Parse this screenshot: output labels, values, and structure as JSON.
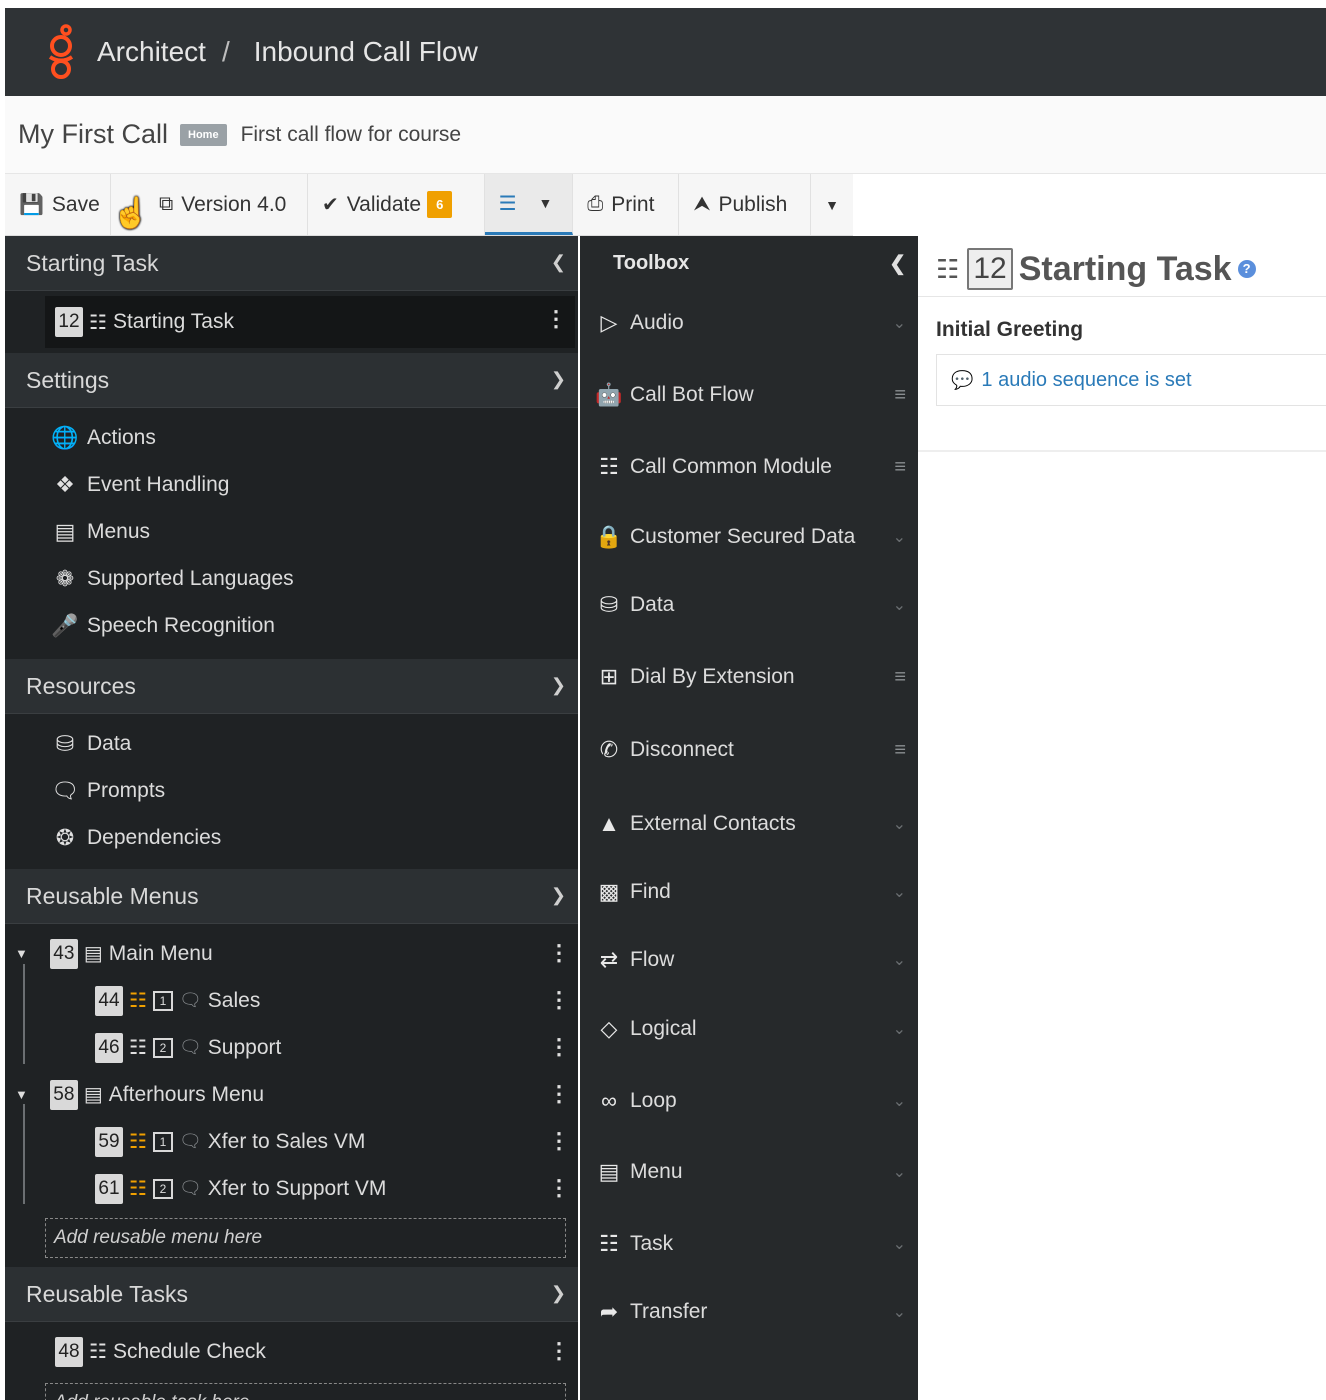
{
  "topbar": {
    "app": "Architect",
    "separator": "/",
    "flow_type": "Inbound Call Flow"
  },
  "flow": {
    "name": "My First Call",
    "badge": "Home",
    "description": "First call flow for course"
  },
  "toolbar": {
    "save": "Save",
    "version": "Version 4.0",
    "validate": "Validate",
    "validate_count": "6",
    "print": "Print",
    "publish": "Publish"
  },
  "starting_task_section": {
    "title": "Starting Task",
    "item": {
      "number": "12",
      "label": "Starting Task"
    }
  },
  "settings": {
    "title": "Settings",
    "items": [
      {
        "label": "Actions",
        "icon": "globe-icon"
      },
      {
        "label": "Event Handling",
        "icon": "event-handling-icon"
      },
      {
        "label": "Menus",
        "icon": "menu-list-icon"
      },
      {
        "label": "Supported Languages",
        "icon": "language-icon"
      },
      {
        "label": "Speech Recognition",
        "icon": "microphone-icon"
      }
    ]
  },
  "resources": {
    "title": "Resources",
    "items": [
      {
        "label": "Data",
        "icon": "database-icon"
      },
      {
        "label": "Prompts",
        "icon": "speech-bubble-icon"
      },
      {
        "label": "Dependencies",
        "icon": "lifebuoy-icon"
      }
    ]
  },
  "reusable_menus": {
    "title": "Reusable Menus",
    "menus": [
      {
        "number": "43",
        "label": "Main Menu",
        "children": [
          {
            "number": "44",
            "key": "1",
            "label": "Sales"
          },
          {
            "number": "46",
            "key": "2",
            "label": "Support"
          }
        ]
      },
      {
        "number": "58",
        "label": "Afterhours Menu",
        "children": [
          {
            "number": "59",
            "key": "1",
            "label": "Xfer to Sales VM"
          },
          {
            "number": "61",
            "key": "2",
            "label": "Xfer to Support VM"
          }
        ]
      }
    ],
    "dropzone": "Add reusable menu here"
  },
  "reusable_tasks": {
    "title": "Reusable Tasks",
    "items": [
      {
        "number": "48",
        "label": "Schedule Check"
      }
    ],
    "dropzone": "Add reusable task here"
  },
  "toolbox": {
    "title": "Toolbox",
    "items": [
      {
        "label": "Audio",
        "icon": "play-circle-icon",
        "right": "chevron"
      },
      {
        "label": "Call Bot Flow",
        "icon": "robot-icon",
        "right": "grip"
      },
      {
        "label": "Call Common Module",
        "icon": "module-icon",
        "right": "grip"
      },
      {
        "label": "Customer Secured Data",
        "icon": "lock-icon",
        "right": "chevron"
      },
      {
        "label": "Data",
        "icon": "database-icon",
        "right": "chevron"
      },
      {
        "label": "Dial By Extension",
        "icon": "hash-icon",
        "right": "grip"
      },
      {
        "label": "Disconnect",
        "icon": "disconnect-icon",
        "right": "grip"
      },
      {
        "label": "External Contacts",
        "icon": "contacts-icon",
        "right": "chevron"
      },
      {
        "label": "Find",
        "icon": "binoculars-icon",
        "right": "chevron"
      },
      {
        "label": "Flow",
        "icon": "shuffle-icon",
        "right": "chevron"
      },
      {
        "label": "Logical",
        "icon": "diamond-icon",
        "right": "chevron"
      },
      {
        "label": "Loop",
        "icon": "loop-icon",
        "right": "chevron"
      },
      {
        "label": "Menu",
        "icon": "menu-list-icon",
        "right": "chevron"
      },
      {
        "label": "Task",
        "icon": "sitemap-icon",
        "right": "chevron"
      },
      {
        "label": "Transfer",
        "icon": "share-icon",
        "right": "chevron"
      }
    ]
  },
  "detail": {
    "number": "12",
    "title": "Starting Task",
    "help": "?",
    "section_label": "Initial Greeting",
    "audio_link": "1 audio sequence is set"
  },
  "colors": {
    "accent": "#2a7ab8",
    "warning_badge": "#f0a000",
    "logo": "#ff4f1f"
  }
}
